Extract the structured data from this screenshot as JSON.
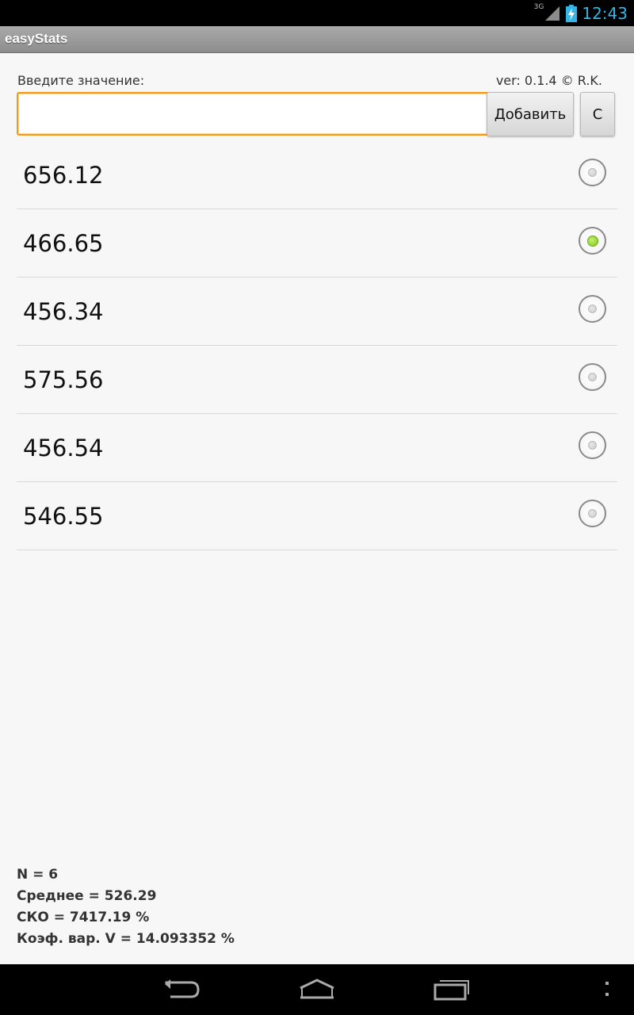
{
  "status_bar": {
    "network_type": "3G",
    "time": "12:43",
    "icons": [
      "signal-icon",
      "battery-charging-icon"
    ]
  },
  "app": {
    "title": "easyStats"
  },
  "input": {
    "label": "Введите значение:",
    "version": "ver: 0.1.4 © R.K.",
    "value": "",
    "placeholder": ""
  },
  "buttons": {
    "add_label": "Добавить",
    "clear_label": "С"
  },
  "values": [
    {
      "value": "656.12",
      "selected": false
    },
    {
      "value": "466.65",
      "selected": true
    },
    {
      "value": "456.34",
      "selected": false
    },
    {
      "value": "575.56",
      "selected": false
    },
    {
      "value": "456.54",
      "selected": false
    },
    {
      "value": "546.55",
      "selected": false
    }
  ],
  "stats": {
    "n": "N = 6",
    "mean": "Среднее = 526.29",
    "sko": "СКО = 7417.19 %",
    "cv": "Коэф. вар. V = 14.093352 %"
  },
  "nav_bar": {
    "icons": [
      "back-icon",
      "home-icon",
      "recent-apps-icon",
      "menu-icon"
    ]
  },
  "colors": {
    "accent_orange": "#f39a1a",
    "clock_blue": "#33b5e5",
    "radio_selected_green": "#7fc81e"
  }
}
